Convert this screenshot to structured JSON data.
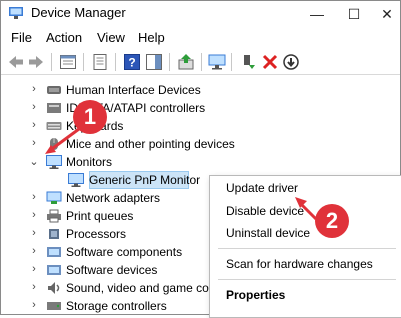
{
  "window": {
    "title": "Device Manager",
    "minimize": "—",
    "maximize": "☐",
    "close": "✕"
  },
  "menu": [
    "File",
    "Action",
    "View",
    "Help"
  ],
  "tree": {
    "rows": [
      {
        "label": "Human Interface Devices",
        "icon": "hid-icon"
      },
      {
        "label": "IDE ATA/ATAPI controllers",
        "icon": "ide-icon"
      },
      {
        "label": "Keyboards",
        "icon": "keyboard-icon"
      },
      {
        "label": "Mice and other pointing devices",
        "icon": "mouse-icon"
      },
      {
        "label": "Monitors",
        "icon": "monitor-icon",
        "expanded": true
      },
      {
        "label": "Generic PnP Monitor",
        "icon": "monitor-icon",
        "child": true,
        "selected": true
      },
      {
        "label": "Network adapters",
        "icon": "network-icon"
      },
      {
        "label": "Print queues",
        "icon": "printer-icon"
      },
      {
        "label": "Processors",
        "icon": "cpu-icon"
      },
      {
        "label": "Software components",
        "icon": "component-icon"
      },
      {
        "label": "Software devices",
        "icon": "component-icon"
      },
      {
        "label": "Sound, video and game controllers",
        "icon": "speaker-icon"
      },
      {
        "label": "Storage controllers",
        "icon": "storage-icon"
      }
    ]
  },
  "context_menu": {
    "items": [
      "Update driver",
      "Disable device",
      "Uninstall device",
      "Scan for hardware changes",
      "Properties"
    ]
  },
  "callouts": {
    "one": "1",
    "two": "2"
  },
  "colors": {
    "accent": "#e0323a",
    "selection": "#cce4f7"
  }
}
